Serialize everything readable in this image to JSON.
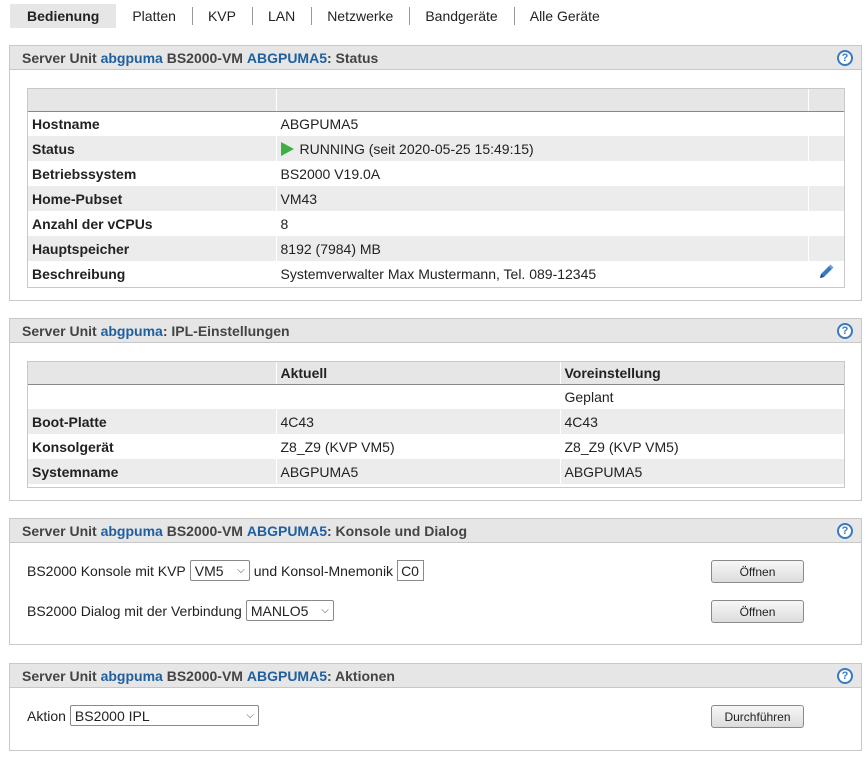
{
  "tabs": [
    "Bedienung",
    "Platten",
    "KVP",
    "LAN",
    "Netzwerke",
    "Bandgeräte",
    "Alle Geräte"
  ],
  "status_panel": {
    "title_prefix": "Server Unit ",
    "server_unit": "abgpuma",
    "title_mid": " BS2000-VM ",
    "vm_name": "ABGPUMA5",
    "title_suffix": ": Status",
    "help": "?",
    "rows": [
      {
        "label": "Hostname",
        "value": "ABGPUMA5"
      },
      {
        "label": "Status",
        "value": "RUNNING (seit 2020-05-25 15:49:15)"
      },
      {
        "label": "Betriebssystem",
        "value": "BS2000 V19.0A"
      },
      {
        "label": "Home-Pubset",
        "value": "VM43"
      },
      {
        "label": "Anzahl der vCPUs",
        "value": "8"
      },
      {
        "label": "Hauptspeicher",
        "value": "8192 (7984) MB"
      },
      {
        "label": "Beschreibung",
        "value": "Systemverwalter Max Mustermann, Tel. 089-12345"
      }
    ],
    "status_color": "#3cb043"
  },
  "ipl_panel": {
    "title_prefix": "Server Unit ",
    "server_unit": "abgpuma",
    "title_suffix": ": IPL-Einstellungen",
    "help": "?",
    "col_current": "Aktuell",
    "col_default": "Voreinstellung",
    "subheader": "Geplant",
    "rows": [
      {
        "label": "Boot-Platte",
        "current": "4C43",
        "default": "4C43"
      },
      {
        "label": "Konsolgerät",
        "current": "Z8_Z9 (KVP VM5)",
        "default": "Z8_Z9 (KVP VM5)"
      },
      {
        "label": "Systemname",
        "current": "ABGPUMA5",
        "default": "ABGPUMA5"
      }
    ]
  },
  "console_panel": {
    "title_prefix": "Server Unit ",
    "server_unit": "abgpuma",
    "title_mid": " BS2000-VM ",
    "vm_name": "ABGPUMA5",
    "title_suffix": ": Konsole und Dialog",
    "help": "?",
    "console_label": "BS2000 Konsole mit KVP",
    "console_kvp": "VM5",
    "mnemonic_label": "und Konsol-Mnemonik",
    "mnemonic_value": "C0",
    "dialog_label": "BS2000 Dialog mit der Verbindung",
    "dialog_connection": "MANLO5",
    "open_label": "Öffnen"
  },
  "actions_panel": {
    "title_prefix": "Server Unit ",
    "server_unit": "abgpuma",
    "title_mid": " BS2000-VM ",
    "vm_name": "ABGPUMA5",
    "title_suffix": ": Aktionen",
    "help": "?",
    "action_label": "Aktion",
    "action_value": "BS2000 IPL",
    "execute_label": "Durchführen"
  },
  "colors": {
    "link": "#1f5f9f",
    "header_bg": "#e6e6e6",
    "help": "#3a7ac0"
  }
}
